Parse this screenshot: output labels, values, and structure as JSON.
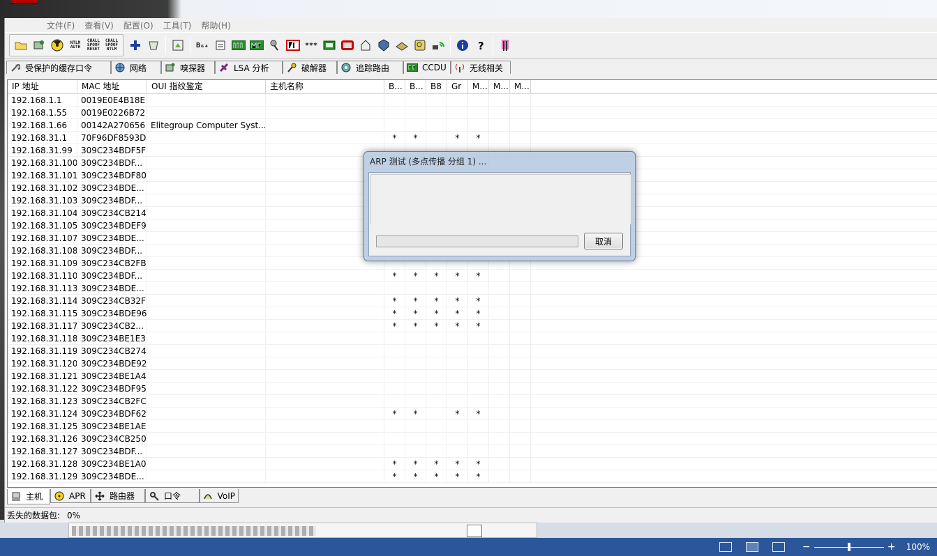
{
  "app": {
    "menu": [
      "文件(F)",
      "查看(V)",
      "配置(O)",
      "工具(T)",
      "帮助(H)"
    ],
    "toolbar": {
      "b64": "B₆₄",
      "ntlm_auth": "NTLM AUTH",
      "chall_spoof_reset": "CHALL SPOOF RESET",
      "chall_spoof_ntlm": "CHALL SPOOF NTLM",
      "asterisks": "***"
    },
    "top_tabs": [
      {
        "label": "受保护的缓存口令",
        "icon": "key-icon"
      },
      {
        "label": "网络",
        "icon": "globe-icon"
      },
      {
        "label": "嗅探器",
        "icon": "sniffer-icon"
      },
      {
        "label": "LSA 分析",
        "icon": "lsa-icon"
      },
      {
        "label": "破解器",
        "icon": "cracker-icon"
      },
      {
        "label": "追踪路由",
        "icon": "traceroute-icon"
      },
      {
        "label": "CCDU",
        "icon": "ccdu-icon"
      },
      {
        "label": "无线相关",
        "icon": "wireless-icon"
      }
    ],
    "columns": [
      "IP 地址",
      "MAC 地址",
      "OUI 指纹鉴定",
      "主机名称",
      "B...",
      "B...",
      "B8",
      "Gr",
      "M...",
      "M...",
      "M..."
    ],
    "rows": [
      [
        "192.168.1.1",
        "0019E0E4B18E",
        "",
        "",
        "",
        "",
        "",
        "",
        "",
        "",
        ""
      ],
      [
        "192.168.1.55",
        "0019E0226B72",
        "",
        "",
        "",
        "",
        "",
        "",
        "",
        "",
        ""
      ],
      [
        "192.168.1.66",
        "00142A270656",
        "Elitegroup Computer Syst...",
        "",
        "",
        "",
        "",
        "",
        "",
        "",
        ""
      ],
      [
        "192.168.31.1",
        "70F96DF8593D",
        "",
        "",
        "*",
        "*",
        "",
        "*",
        "*",
        "",
        ""
      ],
      [
        "192.168.31.99",
        "309C234BDF5F",
        "",
        "",
        "",
        "",
        "",
        "",
        "",
        "",
        ""
      ],
      [
        "192.168.31.100",
        "309C234BDF...",
        "",
        "",
        "",
        "",
        "",
        "",
        "",
        "",
        ""
      ],
      [
        "192.168.31.101",
        "309C234BDF80",
        "",
        "",
        "",
        "",
        "",
        "",
        "",
        "",
        ""
      ],
      [
        "192.168.31.102",
        "309C234BDE...",
        "",
        "",
        "",
        "",
        "",
        "",
        "",
        "",
        ""
      ],
      [
        "192.168.31.103",
        "309C234BDF...",
        "",
        "",
        "",
        "",
        "",
        "",
        "",
        "",
        ""
      ],
      [
        "192.168.31.104",
        "309C234CB214",
        "",
        "",
        "",
        "",
        "",
        "",
        "",
        "",
        ""
      ],
      [
        "192.168.31.105",
        "309C234BDEF9",
        "",
        "",
        "",
        "",
        "",
        "",
        "",
        "",
        ""
      ],
      [
        "192.168.31.107",
        "309C234BDE...",
        "",
        "",
        "",
        "",
        "",
        "",
        "",
        "",
        ""
      ],
      [
        "192.168.31.108",
        "309C234BDF...",
        "",
        "",
        "",
        "",
        "",
        "",
        "",
        "",
        ""
      ],
      [
        "192.168.31.109",
        "309C234CB2FB",
        "",
        "",
        "",
        "",
        "",
        "",
        "",
        "",
        ""
      ],
      [
        "192.168.31.110",
        "309C234BDF...",
        "",
        "",
        "*",
        "*",
        "*",
        "*",
        "*",
        "",
        ""
      ],
      [
        "192.168.31.113",
        "309C234BDE...",
        "",
        "",
        "",
        "",
        "",
        "",
        "",
        "",
        ""
      ],
      [
        "192.168.31.114",
        "309C234CB32F",
        "",
        "",
        "*",
        "*",
        "*",
        "*",
        "*",
        "",
        ""
      ],
      [
        "192.168.31.115",
        "309C234BDE96",
        "",
        "",
        "*",
        "*",
        "*",
        "*",
        "*",
        "",
        ""
      ],
      [
        "192.168.31.117",
        "309C234CB2...",
        "",
        "",
        "*",
        "*",
        "*",
        "*",
        "*",
        "",
        ""
      ],
      [
        "192.168.31.118",
        "309C234BE1E3",
        "",
        "",
        "",
        "",
        "",
        "",
        "",
        "",
        ""
      ],
      [
        "192.168.31.119",
        "309C234CB274",
        "",
        "",
        "",
        "",
        "",
        "",
        "",
        "",
        ""
      ],
      [
        "192.168.31.120",
        "309C234BDE92",
        "",
        "",
        "",
        "",
        "",
        "",
        "",
        "",
        ""
      ],
      [
        "192.168.31.121",
        "309C234BE1A4",
        "",
        "",
        "",
        "",
        "",
        "",
        "",
        "",
        ""
      ],
      [
        "192.168.31.122",
        "309C234BDF95",
        "",
        "",
        "",
        "",
        "",
        "",
        "",
        "",
        ""
      ],
      [
        "192.168.31.123",
        "309C234CB2FC",
        "",
        "",
        "",
        "",
        "",
        "",
        "",
        "",
        ""
      ],
      [
        "192.168.31.124",
        "309C234BDF62",
        "",
        "",
        "*",
        "*",
        "",
        "*",
        "*",
        "",
        ""
      ],
      [
        "192.168.31.125",
        "309C234BE1AE",
        "",
        "",
        "",
        "",
        "",
        "",
        "",
        "",
        ""
      ],
      [
        "192.168.31.126",
        "309C234CB250",
        "",
        "",
        "",
        "",
        "",
        "",
        "",
        "",
        ""
      ],
      [
        "192.168.31.127",
        "309C234BDF...",
        "",
        "",
        "",
        "",
        "",
        "",
        "",
        "",
        ""
      ],
      [
        "192.168.31.128",
        "309C234BE1A0",
        "",
        "",
        "*",
        "*",
        "*",
        "*",
        "*",
        "",
        ""
      ],
      [
        "192.168.31.129",
        "309C234BDE...",
        "",
        "",
        "*",
        "*",
        "*",
        "*",
        "*",
        "",
        ""
      ]
    ],
    "bottom_tabs": [
      {
        "label": "主机",
        "icon": "host-icon"
      },
      {
        "label": "APR",
        "icon": "apr-icon"
      },
      {
        "label": "路由器",
        "icon": "router-icon"
      },
      {
        "label": "口令",
        "icon": "password-icon"
      },
      {
        "label": "VoIP",
        "icon": "voip-icon"
      }
    ],
    "status": {
      "label": "丢失的数据包:",
      "value": "0%"
    }
  },
  "modal": {
    "title": "ARP 测试 (多点传播 分组 1) ...",
    "cancel_label": "取消",
    "progress": 0
  },
  "word_status": {
    "zoom": "100%"
  },
  "colors": {
    "accent": "#2b579a",
    "modal_frame": "#b4c8e1"
  }
}
